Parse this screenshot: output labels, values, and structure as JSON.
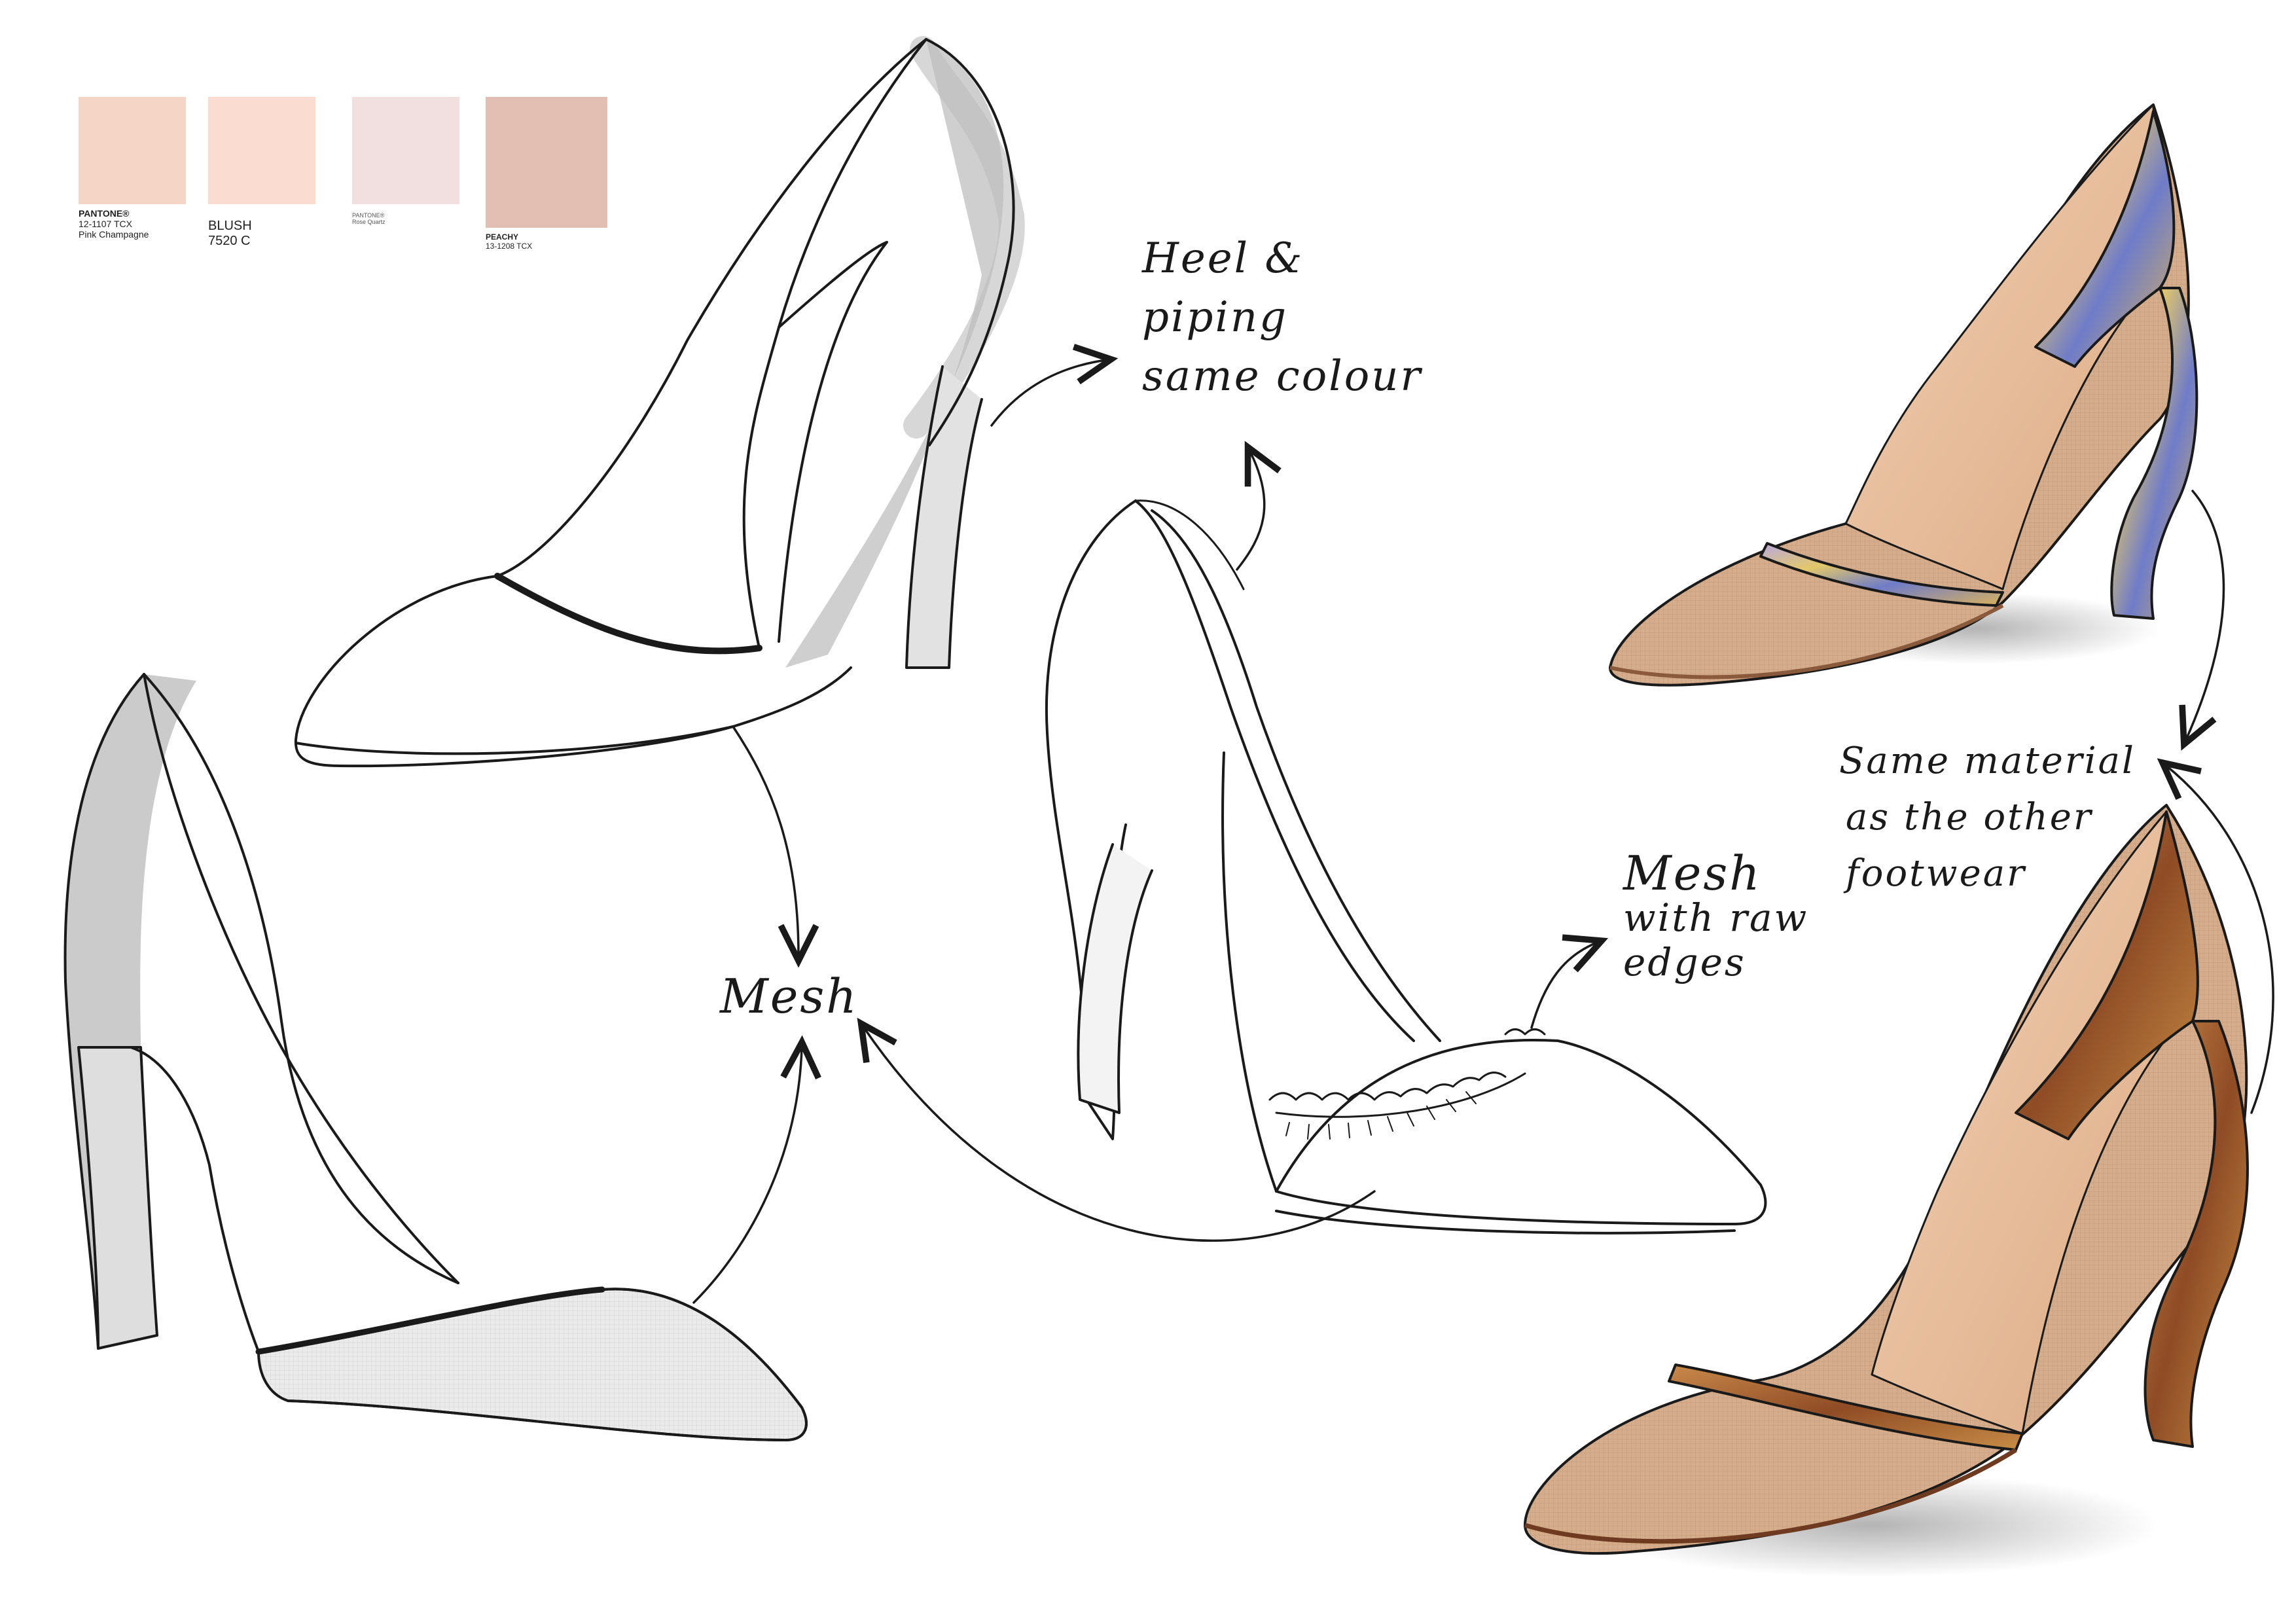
{
  "palette": [
    {
      "lines": [
        "PANTONE®",
        "12-1107 TCX",
        "Pink Champagne"
      ],
      "color": "#f5d5c6"
    },
    {
      "lines": [
        "BLUSH",
        "7520 C"
      ],
      "color": "#fbdcd1"
    },
    {
      "lines": [
        "PANTONE®",
        "Rose Quartz"
      ],
      "color": "#f2dfe0"
    },
    {
      "lines": [
        "PEACHY",
        "13-1208 TCX"
      ],
      "color": "#e2bfb2"
    }
  ],
  "notes": {
    "heel_piping": [
      "Heel &",
      "piping",
      "same colour"
    ],
    "mesh": "Mesh",
    "mesh_raw": [
      "Mesh",
      "with raw",
      "edges"
    ],
    "same_material": [
      "Same material",
      "as the other",
      "footwear"
    ]
  },
  "colors": {
    "line": "#1a1a1a",
    "grey_shade": "#c8c8c8",
    "nude_skin": "#ecc4a2",
    "nude_mesh": "#d9b08f",
    "holo_blue": "#7d7fc4",
    "holo_gold": "#c9a24a",
    "snake_bronze": "#b36d3a"
  },
  "icons": [
    "arrow-curved-icon"
  ]
}
